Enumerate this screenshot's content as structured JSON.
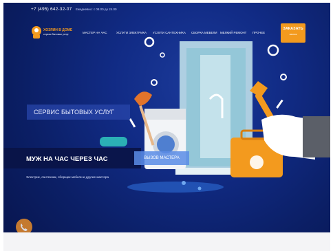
{
  "header": {
    "phone": "+7 (495) 642-32-07",
    "hours": "Ежедневно: с 08.00 до 24.00",
    "logo_text": "ХОЗЯИН В ДОМЕ",
    "logo_sub": "сервис бытовых услуг",
    "order_label": "ЗАКАЗАТЬ",
    "order_sub": "звонок"
  },
  "nav": {
    "items": [
      "МАСТЕР НА ЧАС",
      "УСЛУГИ ЭЛЕКТРИКА",
      "УСЛУГИ САНТЕХНИКА",
      "СБОРКА МЕБЕЛИ",
      "МЕЛКИЙ РЕМОНТ",
      "ПРОЧЕЕ"
    ]
  },
  "hero": {
    "tag1": "СЕРВИС БЫТОВЫХ УСЛУГ",
    "tag2": "МУЖ НА ЧАС ЧЕРЕЗ ЧАС",
    "tag3": "ВЫЗОВ МАСТЕРА",
    "subline": "Электрик, сантехник, сборщик мебели и другие мастера"
  },
  "colors": {
    "accent": "#f39a1e",
    "hero_bg": "#0b1f66"
  }
}
